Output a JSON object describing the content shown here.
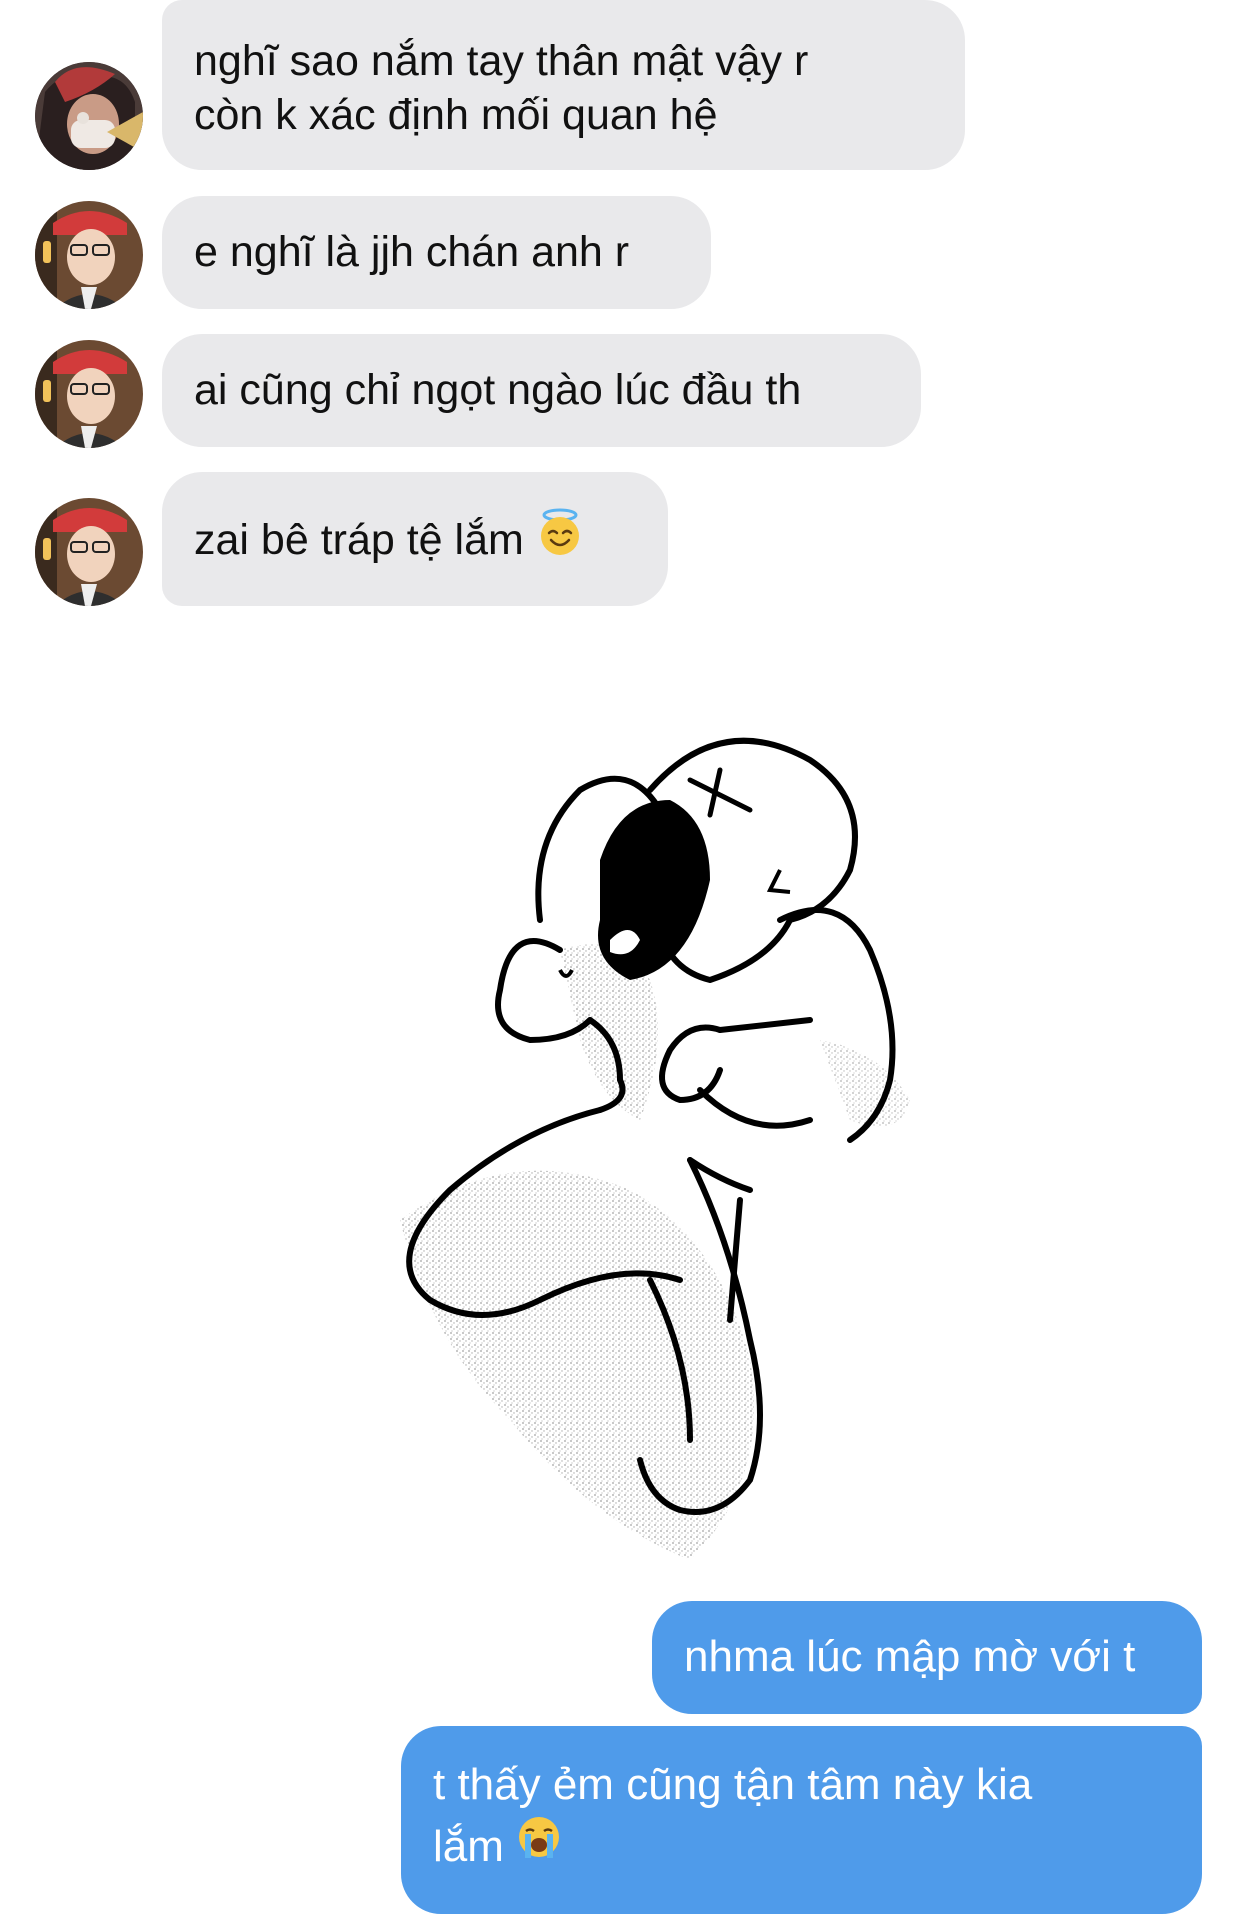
{
  "conversation": {
    "incoming": [
      {
        "line1": "nghĩ sao nắm tay thân mật vậy r",
        "line2": "còn k xác định mối quan hệ"
      },
      {
        "text": "e nghĩ là jjh chán anh r"
      },
      {
        "text": "ai cũng chỉ ngọt ngào lúc đầu th"
      },
      {
        "text": "zai bê tráp tệ lắm",
        "emoji": "smiling-face-with-halo"
      }
    ],
    "sticker": {
      "icon": "crying-character-sticker"
    },
    "outgoing": [
      {
        "text": "nhma lúc mập mờ với t"
      },
      {
        "line1": "t thấy ẻm cũng tận tâm này kia",
        "line2": "lắm",
        "emoji": "loudly-crying-face"
      }
    ]
  },
  "colors": {
    "incoming_bubble": "#e9e9eb",
    "outgoing_bubble": "#4f9bea",
    "background": "#ffffff"
  }
}
